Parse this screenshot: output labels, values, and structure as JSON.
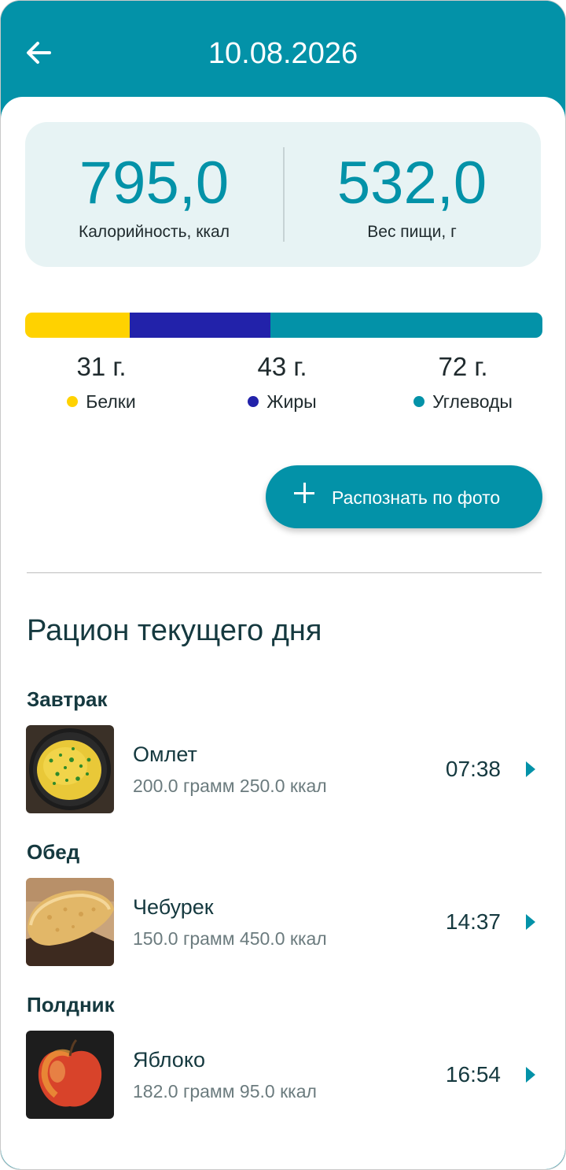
{
  "header": {
    "title": "10.08.2026",
    "back_icon": "arrow-left-icon"
  },
  "summary": {
    "calories": {
      "value": "795,0",
      "label": "Калорийность, ккал"
    },
    "weight": {
      "value": "532,0",
      "label": "Вес пищи, г"
    }
  },
  "macros": {
    "colors": {
      "protein": "#ffd200",
      "fat": "#2222aa",
      "carbs": "#0392a8"
    },
    "shares": {
      "protein": 0.2022,
      "fat": 0.2725,
      "carbs": 0.5253
    },
    "items": [
      {
        "value": "31 г.",
        "label": "Белки"
      },
      {
        "value": "43 г.",
        "label": "Жиры"
      },
      {
        "value": "72 г.",
        "label": "Углеводы"
      }
    ]
  },
  "photo_button": {
    "label": "Распознать по фото",
    "icon": "plus-icon"
  },
  "section_title": "Рацион текущего дня",
  "meals": [
    {
      "header": "Завтрак",
      "name": "Омлет",
      "info": "200.0 грамм 250.0 ккал",
      "time": "07:38",
      "image": "omelet"
    },
    {
      "header": "Обед",
      "name": "Чебурек",
      "info": "150.0 грамм 450.0 ккал",
      "time": "14:37",
      "image": "cheburek"
    },
    {
      "header": "Полдник",
      "name": "Яблоко",
      "info": "182.0 грамм 95.0 ккал",
      "time": "16:54",
      "image": "apple"
    }
  ],
  "colors": {
    "accent": "#0392a8",
    "card_bg": "#e7f3f4",
    "text_dark": "#15393f"
  }
}
